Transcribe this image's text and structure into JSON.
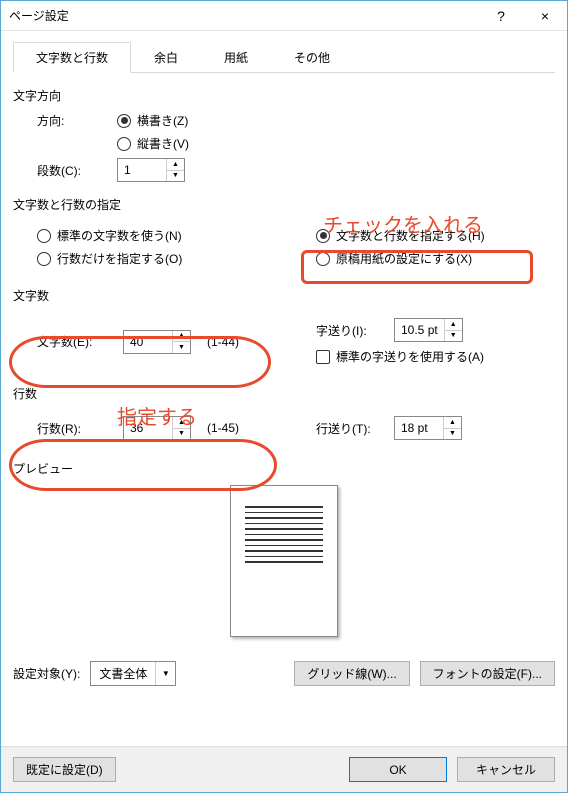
{
  "titlebar": {
    "title": "ページ設定",
    "help": "?",
    "close": "×"
  },
  "tabs": [
    {
      "label": "文字数と行数",
      "active": true
    },
    {
      "label": "余白",
      "active": false
    },
    {
      "label": "用紙",
      "active": false
    },
    {
      "label": "その他",
      "active": false
    }
  ],
  "direction": {
    "section": "文字方向",
    "label": "方向:",
    "horizontal": "横書き(Z)",
    "vertical": "縦書き(V)",
    "columns_label": "段数(C):",
    "columns_value": "1"
  },
  "spec": {
    "section": "文字数と行数の指定",
    "opt_default": "標準の文字数を使う(N)",
    "opt_lines_only": "行数だけを指定する(O)",
    "opt_chars_lines": "文字数と行数を指定する(H)",
    "opt_manuscript": "原稿用紙の設定にする(X)"
  },
  "chars": {
    "section": "文字数",
    "label": "文字数(E):",
    "value": "40",
    "range": "(1-44)",
    "pitch_label": "字送り(I):",
    "pitch_value": "10.5 pt",
    "default_pitch": "標準の字送りを使用する(A)"
  },
  "lines": {
    "section": "行数",
    "label": "行数(R):",
    "value": "36",
    "range": "(1-45)",
    "pitch_label": "行送り(T):",
    "pitch_value": "18 pt"
  },
  "preview": {
    "section": "プレビュー"
  },
  "apply": {
    "label": "設定対象(Y):",
    "value": "文書全体",
    "grid_btn": "グリッド線(W)...",
    "font_btn": "フォントの設定(F)..."
  },
  "footer": {
    "default_btn": "既定に設定(D)",
    "ok": "OK",
    "cancel": "キャンセル"
  },
  "annotations": {
    "check_it": "チェックを入れる",
    "specify": "指定する"
  }
}
